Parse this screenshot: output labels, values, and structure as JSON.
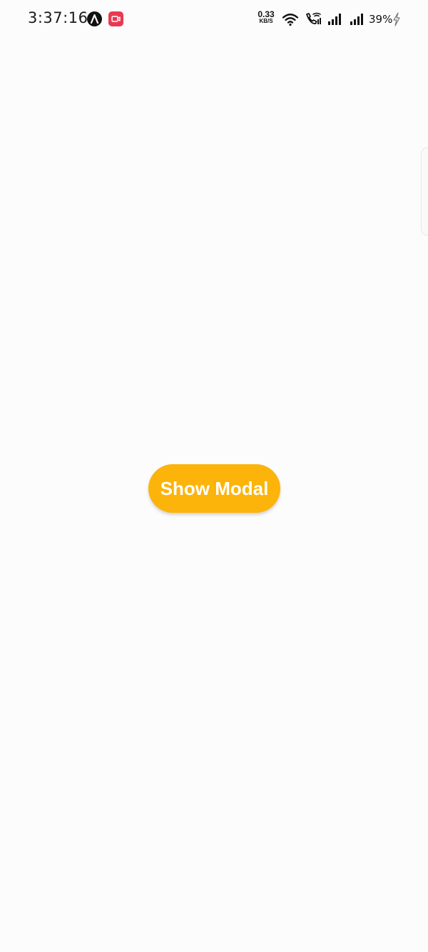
{
  "status_bar": {
    "time": "3:37:16",
    "network_speed_value": "0.33",
    "network_speed_unit": "KB/S",
    "battery_percent": "39%",
    "icons": [
      "app-notification-icon",
      "screen-record-icon",
      "wifi-icon",
      "wifi-calling-icon",
      "signal-icon",
      "signal-icon",
      "charging-icon"
    ],
    "colors": {
      "record_icon": "#ea3850",
      "text": "#111111"
    }
  },
  "main": {
    "show_modal_button_label": "Show Modal",
    "button_color": "#fcb40b",
    "background_color": "#fdfcfd"
  }
}
